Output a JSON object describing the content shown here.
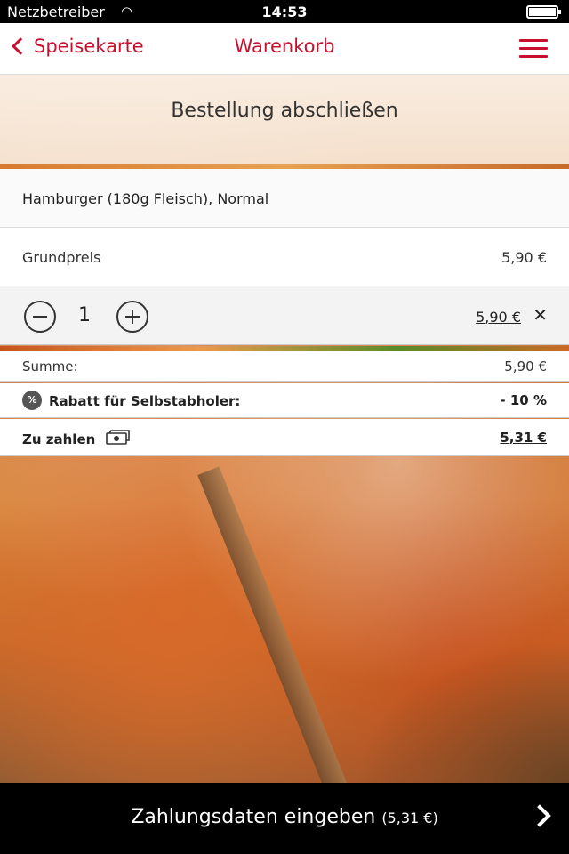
{
  "status": {
    "carrier": "Netzbetreiber",
    "time": "14:53"
  },
  "nav": {
    "back_label": "Speisekarte",
    "title": "Warenkorb"
  },
  "header": {
    "title": "Bestellung abschließen"
  },
  "cart": {
    "item_name": "Hamburger (180g Fleisch), Normal",
    "base_label": "Grundpreis",
    "base_price": "5,90 €",
    "quantity": "1",
    "line_total": "5,90 €",
    "remove_glyph": "✕"
  },
  "summary": {
    "sum_label": "Summe:",
    "sum_value": "5,90 €",
    "discount_badge": "%",
    "discount_label": "Rabatt für Selbstabholer:",
    "discount_value": "- 10 %",
    "pay_label": "Zu zahlen",
    "pay_value": "5,31 €"
  },
  "footer": {
    "cta_label": "Zahlungsdaten eingeben",
    "cta_amount": "(5,31 €)"
  },
  "colors": {
    "accent": "#c8102e",
    "bar": "#000000"
  },
  "icons": [
    "wifi-icon",
    "battery-icon",
    "back-chevron-icon",
    "hamburger-menu-icon",
    "minus-icon",
    "plus-icon",
    "close-icon",
    "percent-badge-icon",
    "cash-icon",
    "chevron-right-icon"
  ]
}
